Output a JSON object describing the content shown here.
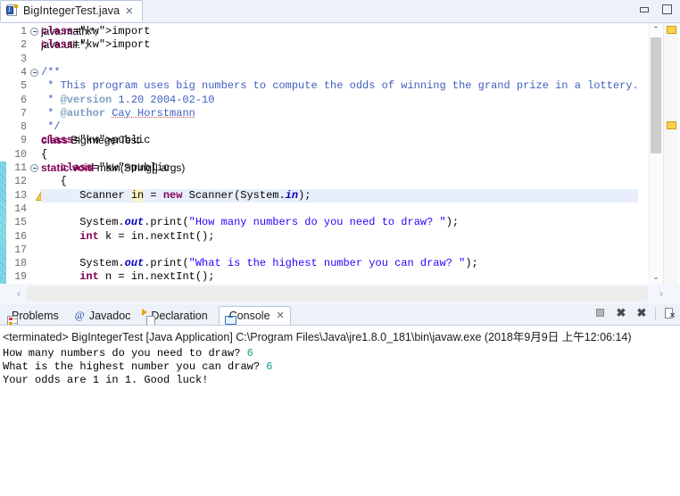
{
  "window": {
    "minimize_label": "Minimize",
    "maximize_label": "Maximize"
  },
  "editor": {
    "tab": {
      "title": "BigIntegerTest.java",
      "close_glyph": "✕",
      "icon": "java-file-icon"
    },
    "lines": [
      {
        "n": "1",
        "fold": true,
        "text": "import java.math.*;"
      },
      {
        "n": "2",
        "fold": false,
        "text": "import java.util.*;"
      },
      {
        "n": "3",
        "fold": false,
        "text": ""
      },
      {
        "n": "4",
        "fold": true,
        "text": "/**"
      },
      {
        "n": "5",
        "fold": false,
        "text": " * This program uses big numbers to compute the odds of winning the grand prize in a lottery."
      },
      {
        "n": "6",
        "fold": false,
        "text": " * @version 1.20 2004-02-10"
      },
      {
        "n": "7",
        "fold": false,
        "text": " * @author Cay Horstmann"
      },
      {
        "n": "8",
        "fold": false,
        "text": " */"
      },
      {
        "n": "9",
        "fold": false,
        "text": "public class BigIntegerTest"
      },
      {
        "n": "10",
        "fold": false,
        "text": "{"
      },
      {
        "n": "11",
        "fold": true,
        "text": "   public static void main(String[] args)"
      },
      {
        "n": "12",
        "fold": false,
        "text": "   {"
      },
      {
        "n": "13",
        "fold": false,
        "text": "      Scanner in = new Scanner(System.in);"
      },
      {
        "n": "14",
        "fold": false,
        "text": ""
      },
      {
        "n": "15",
        "fold": false,
        "text": "      System.out.print(\"How many numbers do you need to draw? \");"
      },
      {
        "n": "16",
        "fold": false,
        "text": "      int k = in.nextInt();"
      },
      {
        "n": "17",
        "fold": false,
        "text": ""
      },
      {
        "n": "18",
        "fold": false,
        "text": "      System.out.print(\"What is the highest number you can draw? \");"
      },
      {
        "n": "19",
        "fold": false,
        "text": "      int n = in.nextInt();"
      }
    ],
    "current_line": "13",
    "warning_line": "13",
    "scroll_left_glyph": "‹",
    "scroll_right_glyph": "›",
    "scroll_up_glyph": "⌃",
    "scroll_down_glyph": "⌄"
  },
  "bottom_panel": {
    "tabs": [
      {
        "label": "Problems",
        "icon": "problems-icon",
        "active": false,
        "closable": false
      },
      {
        "label": "Javadoc",
        "icon": "at-icon",
        "active": false,
        "closable": false
      },
      {
        "label": "Declaration",
        "icon": "declaration-icon",
        "active": false,
        "closable": false
      },
      {
        "label": "Console",
        "icon": "console-icon",
        "active": true,
        "closable": true
      }
    ],
    "close_glyph": "✕",
    "tools": [
      {
        "name": "terminate-button",
        "glyph": ""
      },
      {
        "name": "remove-launch-button",
        "glyph": "✖"
      },
      {
        "name": "remove-all-launch-button",
        "glyph": "✖"
      },
      {
        "name": "open-console-button",
        "glyph": ""
      }
    ],
    "console": {
      "status": "<terminated> BigIntegerTest [Java Application] C:\\Program Files\\Java\\jre1.8.0_181\\bin\\javaw.exe (2018年9月9日 上午12:06:14)",
      "output": [
        {
          "prompt": "How many numbers do you need to draw? ",
          "input": "6"
        },
        {
          "prompt": "What is the highest number you can draw? ",
          "input": "6"
        },
        {
          "prompt": "Your odds are 1 in 1. Good luck!",
          "input": ""
        }
      ]
    }
  },
  "colors": {
    "keyword": "#7f0055",
    "comment": "#3f5fbf",
    "javadoc_tag": "#7f9fbf",
    "string": "#2a00ff",
    "static_field": "#0000c0",
    "current_line_bg": "#e8eefb",
    "change_bar": "#41c0d8",
    "marker": "#ffd24d",
    "console_input": "#1f9c8a"
  }
}
